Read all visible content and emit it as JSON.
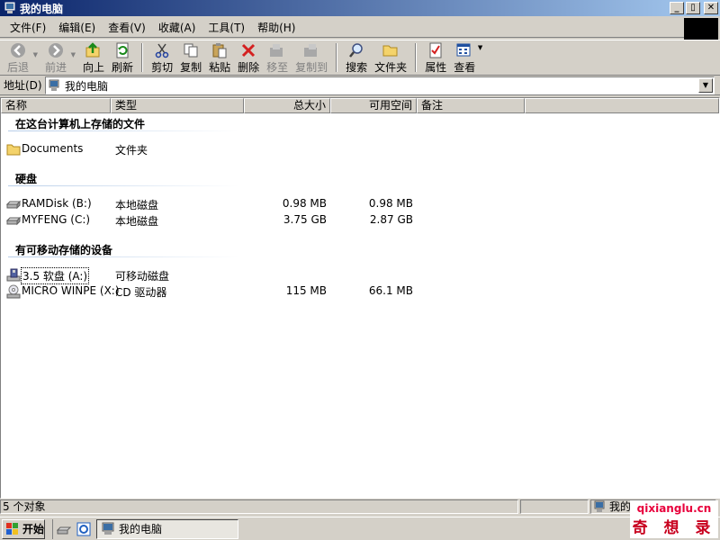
{
  "window": {
    "title": "我的电脑",
    "buttons": [
      "_",
      "▯",
      "✕"
    ]
  },
  "menu": [
    "文件(F)",
    "编辑(E)",
    "查看(V)",
    "收藏(A)",
    "工具(T)",
    "帮助(H)"
  ],
  "toolbar": {
    "back": "后退",
    "forward": "前进",
    "up": "向上",
    "refresh": "刷新",
    "cut": "剪切",
    "copy": "复制",
    "paste": "粘贴",
    "delete": "删除",
    "move_to": "移至",
    "copy_to": "复制到",
    "search": "搜索",
    "folders": "文件夹",
    "properties": "属性",
    "views": "查看"
  },
  "address": {
    "label": "地址(D)",
    "value": "我的电脑"
  },
  "columns": {
    "name": "名称",
    "type": "类型",
    "total_size": "总大小",
    "free_space": "可用空间",
    "comments": "备注"
  },
  "groups": [
    {
      "title": "在这台计算机上存储的文件",
      "items": [
        {
          "name": "Documents",
          "type": "文件夹",
          "total": "",
          "free": "",
          "icon": "folder-icon"
        }
      ]
    },
    {
      "title": "硬盘",
      "items": [
        {
          "name": "RAMDisk (B:)",
          "type": "本地磁盘",
          "total": "0.98 MB",
          "free": "0.98 MB",
          "icon": "hard-drive-icon"
        },
        {
          "name": "MYFENG (C:)",
          "type": "本地磁盘",
          "total": "3.75 GB",
          "free": "2.87 GB",
          "icon": "hard-drive-icon"
        }
      ]
    },
    {
      "title": "有可移动存储的设备",
      "items": [
        {
          "name": "3.5 软盘 (A:)",
          "type": "可移动磁盘",
          "total": "",
          "free": "",
          "icon": "floppy-drive-icon"
        },
        {
          "name": "MICRO WINPE (X:)",
          "type": "CD 驱动器",
          "total": "115 MB",
          "free": "66.1 MB",
          "icon": "cd-drive-icon"
        }
      ]
    }
  ],
  "status": {
    "objects": "5 个对象",
    "location": "我的电脑"
  },
  "taskbar": {
    "start": "开始",
    "task": "我的电脑"
  },
  "watermark": {
    "site": "qixianglu.cn",
    "name": "奇 想 录"
  }
}
